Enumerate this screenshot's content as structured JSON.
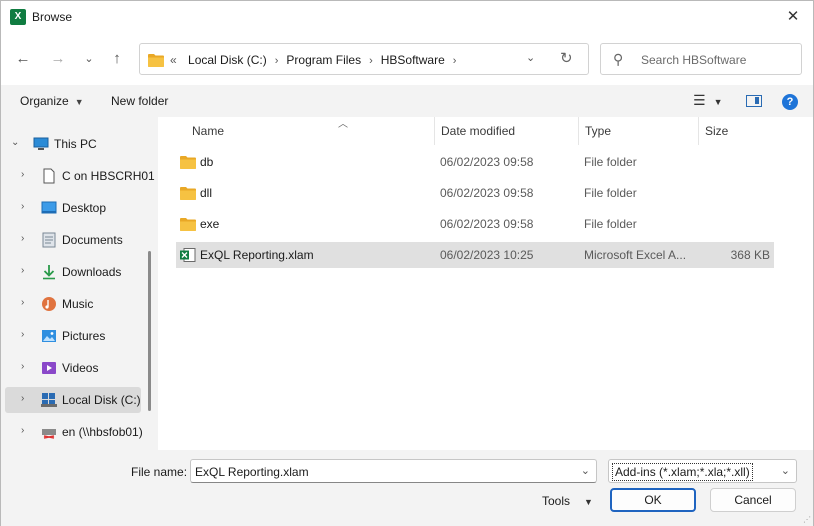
{
  "window": {
    "title": "Browse",
    "app_icon": "excel-icon",
    "app_icon_glyph": "X"
  },
  "nav": {
    "back_icon": "←",
    "forward_icon": "→",
    "recent_icon": "⌄",
    "up_icon": "↑"
  },
  "address": {
    "overflow": "«",
    "crumbs": [
      "Local Disk (C:)",
      "Program Files",
      "HBSoftware"
    ],
    "separator": "›",
    "dropdown": "⌄",
    "refresh": "↻"
  },
  "search": {
    "placeholder": "Search HBSoftware"
  },
  "toolbar": {
    "organize": "Organize",
    "new_folder": "New folder",
    "help": "?"
  },
  "tree": [
    {
      "label": "This PC",
      "icon": "pc-icon",
      "level": 0,
      "expanded": true
    },
    {
      "label": "C on HBSCRH01",
      "icon": "document-icon",
      "level": 1
    },
    {
      "label": "Desktop",
      "icon": "desktop-icon",
      "level": 1
    },
    {
      "label": "Documents",
      "icon": "documents-icon",
      "level": 1
    },
    {
      "label": "Downloads",
      "icon": "download-icon",
      "level": 1
    },
    {
      "label": "Music",
      "icon": "music-icon",
      "level": 1
    },
    {
      "label": "Pictures",
      "icon": "pictures-icon",
      "level": 1
    },
    {
      "label": "Videos",
      "icon": "videos-icon",
      "level": 1
    },
    {
      "label": "Local Disk (C:)",
      "icon": "drive-icon",
      "level": 1,
      "selected": true
    },
    {
      "label": "en (\\\\hbsfob01)",
      "icon": "network-drive-icon",
      "level": 1
    }
  ],
  "columns": {
    "name": "Name",
    "date": "Date modified",
    "type": "Type",
    "size": "Size"
  },
  "files": [
    {
      "name": "db",
      "date": "06/02/2023 09:58",
      "type": "File folder",
      "size": "",
      "icon": "folder-icon"
    },
    {
      "name": "dll",
      "date": "06/02/2023 09:58",
      "type": "File folder",
      "size": "",
      "icon": "folder-icon"
    },
    {
      "name": "exe",
      "date": "06/02/2023 09:58",
      "type": "File folder",
      "size": "",
      "icon": "folder-icon"
    },
    {
      "name": "ExQL Reporting.xlam",
      "date": "06/02/2023 10:25",
      "type": "Microsoft Excel A...",
      "size": "368 KB",
      "icon": "excel-file-icon",
      "selected": true
    }
  ],
  "bottom": {
    "file_name_label": "File name:",
    "file_name_value": "ExQL Reporting.xlam",
    "filter": "Add-ins (*.xlam;*.xla;*.xll)",
    "tools": "Tools",
    "ok": "OK",
    "cancel": "Cancel"
  },
  "colors": {
    "accent": "#1f64c0",
    "excel_green": "#107c41",
    "folder_yellow": "#f6c242",
    "selection": "#e0e0e0"
  }
}
